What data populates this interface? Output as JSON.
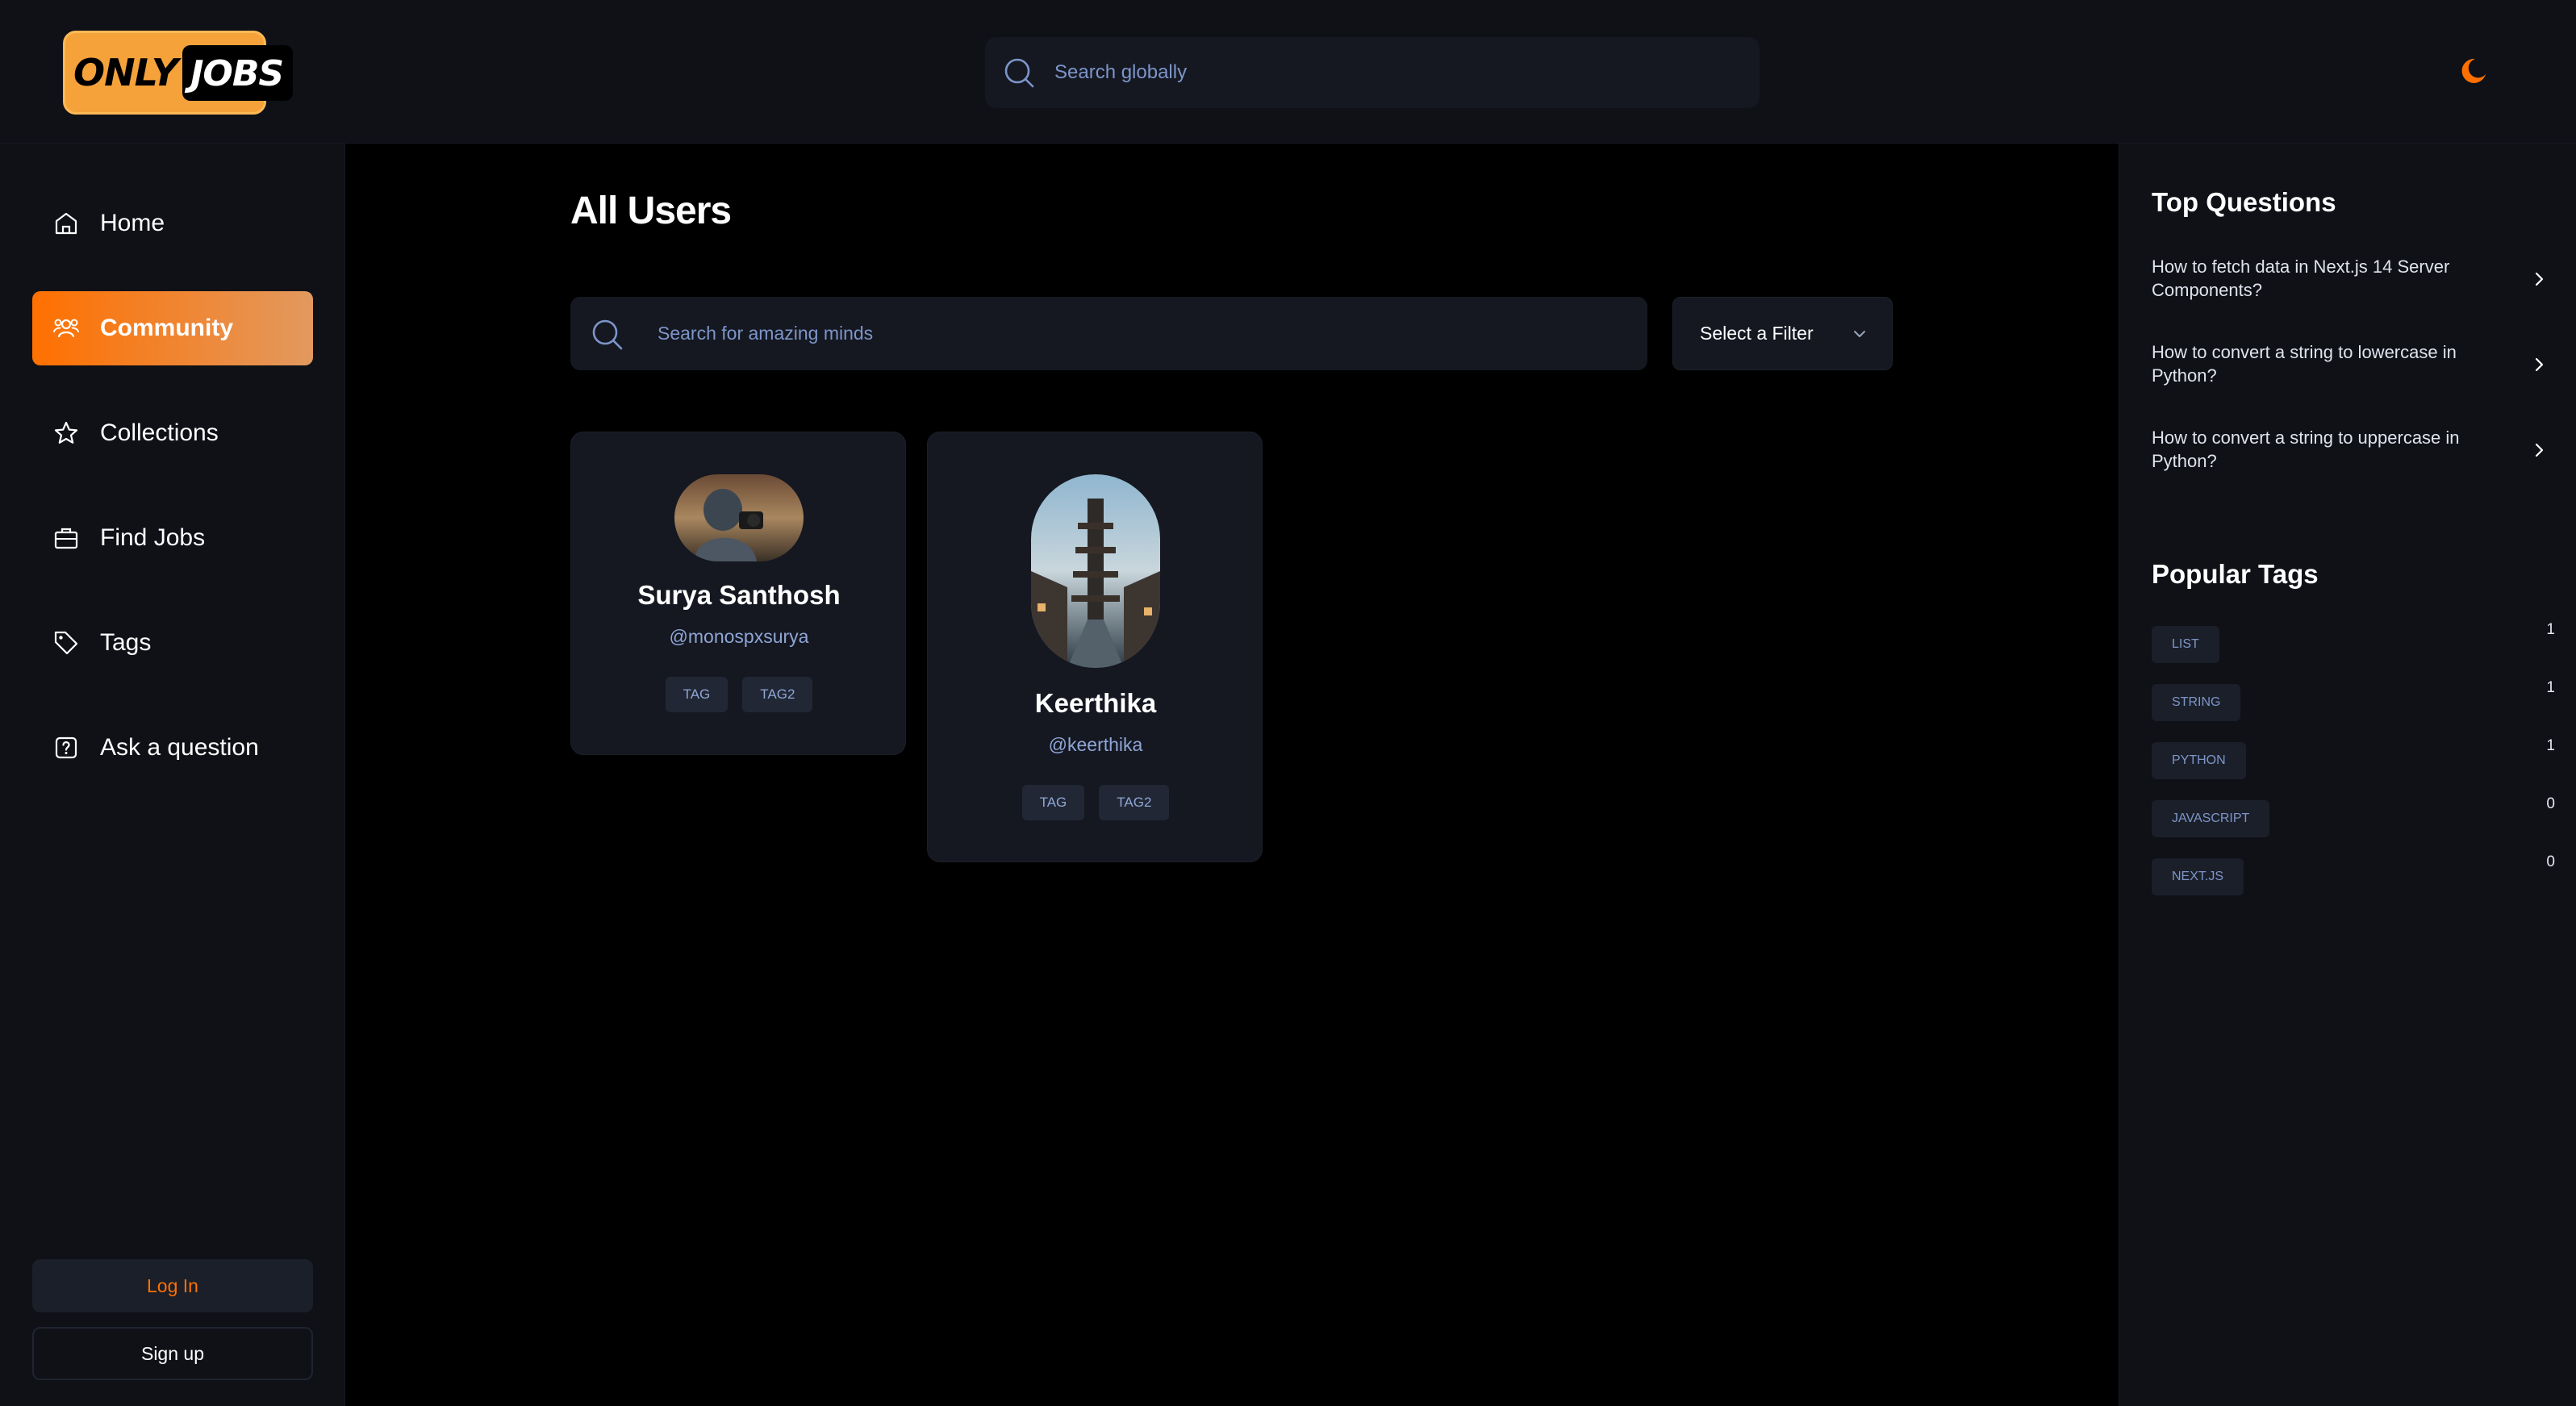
{
  "brand": {
    "word1": "ONLY",
    "word2": "JOBS"
  },
  "header": {
    "search_placeholder": "Search globally"
  },
  "sidebar": {
    "items": [
      {
        "label": "Home",
        "icon": "home-icon",
        "active": false
      },
      {
        "label": "Community",
        "icon": "users-icon",
        "active": true
      },
      {
        "label": "Collections",
        "icon": "star-icon",
        "active": false
      },
      {
        "label": "Find Jobs",
        "icon": "briefcase-icon",
        "active": false
      },
      {
        "label": "Tags",
        "icon": "tag-icon",
        "active": false
      },
      {
        "label": "Ask a question",
        "icon": "question-icon",
        "active": false
      }
    ],
    "login_label": "Log In",
    "signup_label": "Sign up"
  },
  "main": {
    "title": "All Users",
    "search_placeholder": "Search for amazing minds",
    "filter_label": "Select a Filter",
    "users": [
      {
        "name": "Surya Santhosh",
        "handle": "@monospxsurya",
        "tags": [
          "TAG",
          "TAG2"
        ]
      },
      {
        "name": "Keerthika",
        "handle": "@keerthika",
        "tags": [
          "TAG",
          "TAG2"
        ]
      }
    ]
  },
  "right_sidebar": {
    "top_questions_title": "Top Questions",
    "questions": [
      {
        "line1": "How to fetch data in Next.js 14 Server",
        "line2": "Components?"
      },
      {
        "line1": "How to convert a string to lowercase in",
        "line2": "Python?"
      },
      {
        "line1": "How to convert a string to uppercase in",
        "line2": "Python?"
      }
    ],
    "popular_tags_title": "Popular Tags",
    "tags": [
      {
        "name": "LIST",
        "count": "1"
      },
      {
        "name": "STRING",
        "count": "1"
      },
      {
        "name": "PYTHON",
        "count": "1"
      },
      {
        "name": "JAVASCRIPT",
        "count": "0"
      },
      {
        "name": "NEXT.JS",
        "count": "0"
      }
    ]
  },
  "colors": {
    "accent": "#ff7000",
    "accent_light": "#e2995f",
    "panel": "#0f1117",
    "card": "#151821",
    "muted_text": "#8fa6d6"
  }
}
